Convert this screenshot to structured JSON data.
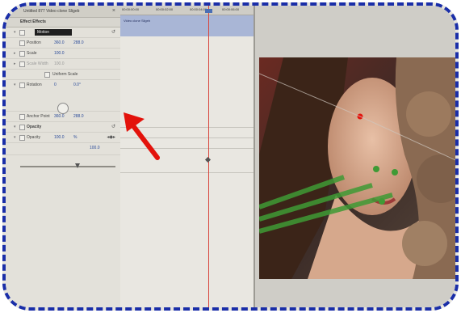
{
  "window": {
    "title": "Untitled 877 Video clone Sligeb",
    "panel_header": "Effect Effects"
  },
  "ruler_labels": [
    "00:00:00:00",
    "00:00:02:00",
    "00:00:04:00",
    "00:00:06:00"
  ],
  "clip": {
    "name": "Video clone Sligeb"
  },
  "controls": [
    {
      "id": "motion",
      "label": "Motion",
      "v1": "",
      "v2": ""
    },
    {
      "id": "position",
      "label": "Position",
      "v1": "360.0",
      "v2": "288.0"
    },
    {
      "id": "scale",
      "label": "Scale",
      "v1": "100.0",
      "v2": ""
    },
    {
      "id": "scale_width",
      "label": "Scale Width",
      "v1": "100.0",
      "v2": ""
    },
    {
      "id": "uniform_scale",
      "label": "Uniform Scale",
      "v1": "",
      "v2": ""
    },
    {
      "id": "rotation",
      "label": "Rotation",
      "v1": "0",
      "v2": "0.0°"
    },
    {
      "id": "anchor_point",
      "label": "Anchor Point",
      "v1": "360.0",
      "v2": "288.0"
    },
    {
      "id": "opacity_group",
      "label": "Opacity",
      "v1": "",
      "v2": ""
    },
    {
      "id": "opacity",
      "label": "Opacity",
      "v1": "100.0",
      "v2": "%"
    }
  ],
  "opacity_value_right": "100.0",
  "colors": {
    "frame": "#1a2ea8",
    "arrow": "#e3120b",
    "playhead": "#d8433b",
    "tracking": "#3f9a35"
  },
  "icons": {
    "arrow": "red-arrow",
    "dial": "rotation-dial",
    "reset": "reset-icon"
  }
}
